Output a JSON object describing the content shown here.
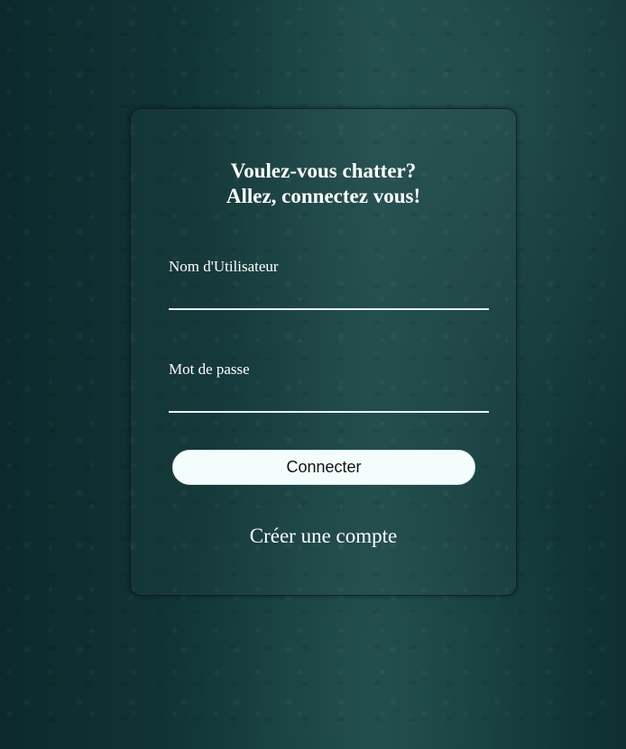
{
  "login": {
    "title_line1": "Voulez-vous chatter?",
    "title_line2": "Allez, connectez vous!",
    "username_label": "Nom d'Utilisateur",
    "username_value": "",
    "password_label": "Mot de passe",
    "password_value": "",
    "connect_label": "Connecter",
    "create_account_label": "Créer une compte"
  },
  "colors": {
    "background": "#143a3a",
    "text": "#ffffff",
    "button_bg": "#f3fdfc"
  }
}
